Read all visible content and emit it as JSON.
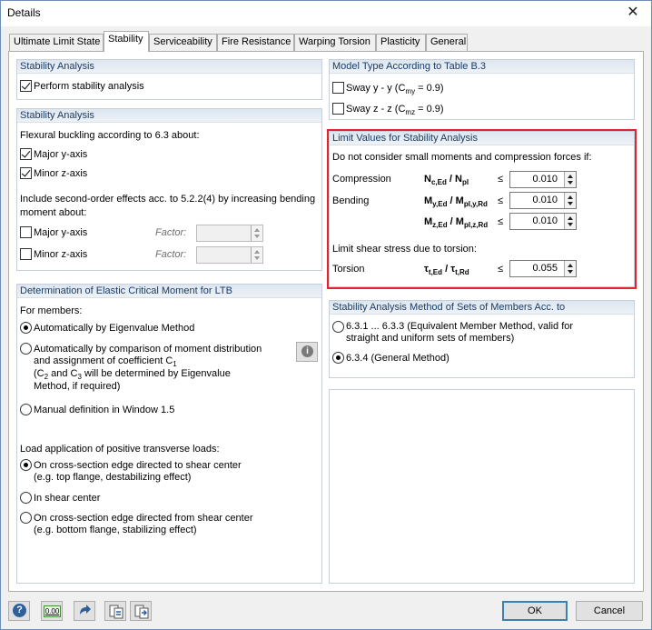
{
  "window": {
    "title": "Details"
  },
  "tabs": [
    "Ultimate Limit State",
    "Stability",
    "Serviceability",
    "Fire Resistance",
    "Warping Torsion",
    "Plasticity",
    "General"
  ],
  "stability_analysis_1": {
    "header": "Stability Analysis",
    "perform_label": "Perform stability analysis",
    "perform_checked": true
  },
  "stability_analysis_2": {
    "header": "Stability Analysis",
    "flexural_label": "Flexural buckling according to 6.3 about:",
    "major_label": "Major y-axis",
    "minor_label": "Minor z-axis",
    "second_order_line1": "Include second-order effects acc. to 5.2.2(4) by increasing bending",
    "second_order_line2": "moment about:",
    "so_major_label": "Major y-axis",
    "so_minor_label": "Minor z-axis",
    "factor_label": "Factor:"
  },
  "ltb": {
    "header": "Determination of Elastic Critical Moment for LTB",
    "for_members": "For members:",
    "opt_eigen": "Automatically by Eigenvalue Method",
    "opt_moment_1": "Automatically by comparison of moment distribution",
    "opt_moment_2": "and assignment of coefficient C",
    "opt_moment_2_sub": "1",
    "opt_moment_3a": "(C",
    "opt_moment_3b": " and C",
    "opt_moment_3c": " will be determined by Eigenvalue",
    "opt_moment_3_sub1": "2",
    "opt_moment_3_sub2": "3",
    "opt_moment_4": "Method, if required)",
    "opt_manual": "Manual definition in Window 1.5",
    "load_label": "Load application of positive transverse loads:",
    "load_opt1_a": "On cross-section edge directed to shear center",
    "load_opt1_b": "(e.g. top flange, destabilizing effect)",
    "load_opt2": "In shear center",
    "load_opt3_a": "On cross-section edge directed from shear center",
    "load_opt3_b": "(e.g. bottom flange, stabilizing effect)",
    "info_icon": "info-icon"
  },
  "model_type": {
    "header": "Model Type According to Table B.3",
    "sway_y_a": "Sway y - y (C",
    "sway_y_sub": "my",
    "sway_y_b": " = 0.9)",
    "sway_z_a": "Sway z - z (C",
    "sway_z_sub": "mz",
    "sway_z_b": " = 0.9)"
  },
  "limit_values": {
    "header": "Limit Values for Stability Analysis",
    "intro": "Do not consider small moments and compression forces if:",
    "compression_label": "Compression",
    "compression_formula_a": "N",
    "compression_formula_sub1": "c,Ed",
    "compression_formula_b": " / N",
    "compression_formula_sub2": "pl",
    "bending_label": "Bending",
    "bending_y_a": "M",
    "bending_y_sub1": "y,Ed",
    "bending_y_b": " / M",
    "bending_y_sub2": "pl,y,Rd",
    "bending_z_a": "M",
    "bending_z_sub1": "z,Ed",
    "bending_z_b": " / M",
    "bending_z_sub2": "pl,z,Rd",
    "le": "≤",
    "compression_value": "0.010",
    "bending_y_value": "0.010",
    "bending_z_value": "0.010",
    "shear_label": "Limit shear stress due to torsion:",
    "torsion_label": "Torsion",
    "torsion_formula_a": "τ",
    "torsion_formula_sub1": "t,Ed",
    "torsion_formula_b": " / τ",
    "torsion_formula_sub2": "t,Rd",
    "torsion_value": "0.055"
  },
  "method": {
    "header": "Stability Analysis Method of Sets of Members Acc. to",
    "opt1_a": "6.3.1 ... 6.3.3 (Equivalent Member Method, valid for",
    "opt1_b": "straight and uniform sets of members)",
    "opt2": "6.3.4 (General Method)"
  },
  "footer": {
    "ok": "OK",
    "cancel": "Cancel",
    "zero_label": "0.00"
  },
  "colors": {
    "highlight": "#e0262a",
    "group_header_text": "#1a3c66",
    "default_button_border": "#3c7fb1"
  }
}
